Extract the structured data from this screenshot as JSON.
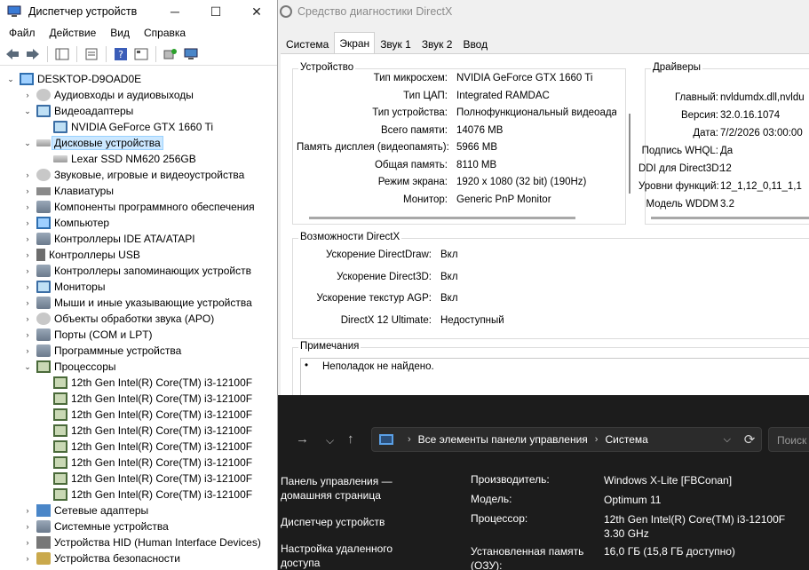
{
  "device_manager": {
    "title": "Диспетчер устройств",
    "menu": [
      "Файл",
      "Действие",
      "Вид",
      "Справка"
    ],
    "tree": [
      {
        "label": "DESKTOP-D9OAD0E",
        "level": 0,
        "expanded": true,
        "icon": "computer-icon"
      },
      {
        "label": "Аудиовходы и аудиовыходы",
        "level": 1,
        "expanded": false,
        "icon": "audio-icon"
      },
      {
        "label": "Видеоадаптеры",
        "level": 1,
        "expanded": true,
        "icon": "display-adapter-icon"
      },
      {
        "label": "NVIDIA GeForce GTX 1660 Ti",
        "level": 2,
        "icon": "display-adapter-icon"
      },
      {
        "label": "Дисковые устройства",
        "level": 1,
        "expanded": true,
        "selected": true,
        "icon": "disk-icon"
      },
      {
        "label": "Lexar SSD NM620 256GB",
        "level": 2,
        "icon": "disk-icon"
      },
      {
        "label": "Звуковые, игровые и видеоустройства",
        "level": 1,
        "expanded": false,
        "icon": "sound-icon"
      },
      {
        "label": "Клавиатуры",
        "level": 1,
        "expanded": false,
        "icon": "keyboard-icon"
      },
      {
        "label": "Компоненты программного обеспечения",
        "level": 1,
        "expanded": false,
        "icon": "software-icon"
      },
      {
        "label": "Компьютер",
        "level": 1,
        "expanded": false,
        "icon": "computer-icon"
      },
      {
        "label": "Контроллеры IDE ATA/ATAPI",
        "level": 1,
        "expanded": false,
        "icon": "ide-icon"
      },
      {
        "label": "Контроллеры USB",
        "level": 1,
        "expanded": false,
        "icon": "usb-icon"
      },
      {
        "label": "Контроллеры запоминающих устройств",
        "level": 1,
        "expanded": false,
        "icon": "storage-icon"
      },
      {
        "label": "Мониторы",
        "level": 1,
        "expanded": false,
        "icon": "monitor-icon"
      },
      {
        "label": "Мыши и иные указывающие устройства",
        "level": 1,
        "expanded": false,
        "icon": "mouse-icon"
      },
      {
        "label": "Объекты обработки звука (APO)",
        "level": 1,
        "expanded": false,
        "icon": "apo-icon"
      },
      {
        "label": "Порты (COM и LPT)",
        "level": 1,
        "expanded": false,
        "icon": "port-icon"
      },
      {
        "label": "Программные устройства",
        "level": 1,
        "expanded": false,
        "icon": "software-device-icon"
      },
      {
        "label": "Процессоры",
        "level": 1,
        "expanded": true,
        "icon": "cpu-icon"
      },
      {
        "label": "12th Gen Intel(R) Core(TM) i3-12100F",
        "level": 2,
        "icon": "cpu-icon"
      },
      {
        "label": "12th Gen Intel(R) Core(TM) i3-12100F",
        "level": 2,
        "icon": "cpu-icon"
      },
      {
        "label": "12th Gen Intel(R) Core(TM) i3-12100F",
        "level": 2,
        "icon": "cpu-icon"
      },
      {
        "label": "12th Gen Intel(R) Core(TM) i3-12100F",
        "level": 2,
        "icon": "cpu-icon"
      },
      {
        "label": "12th Gen Intel(R) Core(TM) i3-12100F",
        "level": 2,
        "icon": "cpu-icon"
      },
      {
        "label": "12th Gen Intel(R) Core(TM) i3-12100F",
        "level": 2,
        "icon": "cpu-icon"
      },
      {
        "label": "12th Gen Intel(R) Core(TM) i3-12100F",
        "level": 2,
        "icon": "cpu-icon"
      },
      {
        "label": "12th Gen Intel(R) Core(TM) i3-12100F",
        "level": 2,
        "icon": "cpu-icon"
      },
      {
        "label": "Сетевые адаптеры",
        "level": 1,
        "expanded": false,
        "icon": "network-icon"
      },
      {
        "label": "Системные устройства",
        "level": 1,
        "expanded": false,
        "icon": "system-icon"
      },
      {
        "label": "Устройства HID (Human Interface Devices)",
        "level": 1,
        "expanded": false,
        "icon": "hid-icon"
      },
      {
        "label": "Устройства безопасности",
        "level": 1,
        "expanded": false,
        "icon": "security-icon"
      }
    ]
  },
  "directx": {
    "title": "Средство диагностики DirectX",
    "tabs": [
      "Система",
      "Экран",
      "Звук 1",
      "Звук 2",
      "Ввод"
    ],
    "active_tab": "Экран",
    "device": {
      "label": "Устройство",
      "rows": [
        {
          "k": "Тип микросхем:",
          "v": "NVIDIA GeForce GTX 1660 Ti"
        },
        {
          "k": "Тип ЦАП:",
          "v": "Integrated RAMDAC"
        },
        {
          "k": "Тип устройства:",
          "v": "Полнофункциональный видеоадапт"
        },
        {
          "k": "Всего памяти:",
          "v": "14076 MB"
        },
        {
          "k": "Память дисплея (видеопамять):",
          "v": "5966 MB"
        },
        {
          "k": "Общая память:",
          "v": "8110 MB"
        },
        {
          "k": "Режим экрана:",
          "v": "1920 x 1080 (32 bit) (190Hz)"
        },
        {
          "k": "Монитор:",
          "v": "Generic PnP Monitor"
        }
      ]
    },
    "drivers": {
      "label": "Драйверы",
      "rows": [
        {
          "k": "Главный:",
          "v": "nvldumdx.dll,nvldu"
        },
        {
          "k": "Версия:",
          "v": "32.0.16.1074"
        },
        {
          "k": "Дата:",
          "v": "7/2/2026 03:00:00"
        },
        {
          "k": "Подпись WHQL:",
          "v": "Да"
        },
        {
          "k": "DDI для Direct3D:",
          "v": "12"
        },
        {
          "k": "Уровни функций:",
          "v": "12_1,12_0,11_1,1"
        },
        {
          "k": "Модель WDDM",
          "v": "3.2"
        }
      ]
    },
    "features": {
      "label": "Возможности DirectX",
      "rows": [
        {
          "k": "Ускорение DirectDraw:",
          "v": "Вкл"
        },
        {
          "k": "Ускорение Direct3D:",
          "v": "Вкл"
        },
        {
          "k": "Ускорение текстур AGP:",
          "v": "Вкл"
        },
        {
          "k": "DirectX 12 Ultimate:",
          "v": "Недоступный"
        }
      ]
    },
    "notes": {
      "label": "Примечания",
      "items": [
        "Неполадок не найдено."
      ]
    }
  },
  "control_panel": {
    "breadcrumb": [
      "Все элементы панели управления",
      "Система"
    ],
    "search_placeholder": "Поиск",
    "sidebar": [
      "Панель управления — домашняя страница",
      "Диспетчер устройств",
      "Настройка удаленного доступа"
    ],
    "info": [
      {
        "k": "Производитель:",
        "v": "Windows X-Lite [FBConan]"
      },
      {
        "k": "Модель:",
        "v": "Optimum 11"
      },
      {
        "k": "Процессор:",
        "v": "12th Gen Intel(R) Core(TM) i3-12100F   3.30 GHz"
      },
      {
        "k": "Установленная память (ОЗУ):",
        "v": "16,0 ГБ (15,8 ГБ доступно)"
      }
    ]
  }
}
